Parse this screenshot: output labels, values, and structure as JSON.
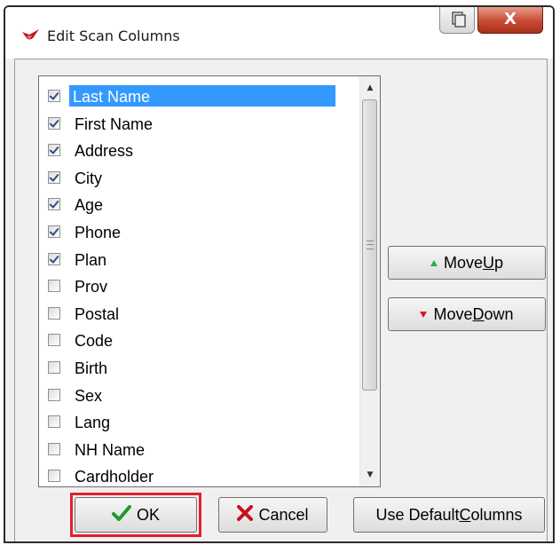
{
  "window": {
    "title": "Edit Scan Columns",
    "close_glyph": "X"
  },
  "columns": [
    {
      "label": "Last Name",
      "checked": true,
      "selected": true
    },
    {
      "label": "First Name",
      "checked": true
    },
    {
      "label": "Address",
      "checked": true
    },
    {
      "label": "City",
      "checked": true
    },
    {
      "label": "Age",
      "checked": true
    },
    {
      "label": "Phone",
      "checked": true
    },
    {
      "label": "Plan",
      "checked": true
    },
    {
      "label": "Prov",
      "checked": false
    },
    {
      "label": "Postal",
      "checked": false
    },
    {
      "label": "Code",
      "checked": false
    },
    {
      "label": "Birth",
      "checked": false
    },
    {
      "label": "Sex",
      "checked": false
    },
    {
      "label": "Lang",
      "checked": false
    },
    {
      "label": "NH Name",
      "checked": false
    },
    {
      "label": "Cardholder",
      "checked": false
    }
  ],
  "buttons": {
    "move_up": {
      "pre": "Move ",
      "ul": "U",
      "post": "p"
    },
    "move_down": {
      "pre": "Move ",
      "ul": "D",
      "post": "own"
    },
    "ok": {
      "label": "OK"
    },
    "cancel": {
      "label": "Cancel"
    },
    "defaults": {
      "pre": "Use Default ",
      "ul": "C",
      "post": "olumns"
    }
  },
  "colors": {
    "selection": "#3399ff",
    "highlight_frame": "#e3202b",
    "move_up_arrow": "#22b14c",
    "move_down_arrow": "#e0141e",
    "close_button": "#c74a33"
  },
  "icons": [
    "app-logo-icon",
    "restore-icon",
    "close-icon",
    "checkmark-icon",
    "red-x-icon",
    "arrow-up-icon",
    "arrow-down-icon"
  ]
}
